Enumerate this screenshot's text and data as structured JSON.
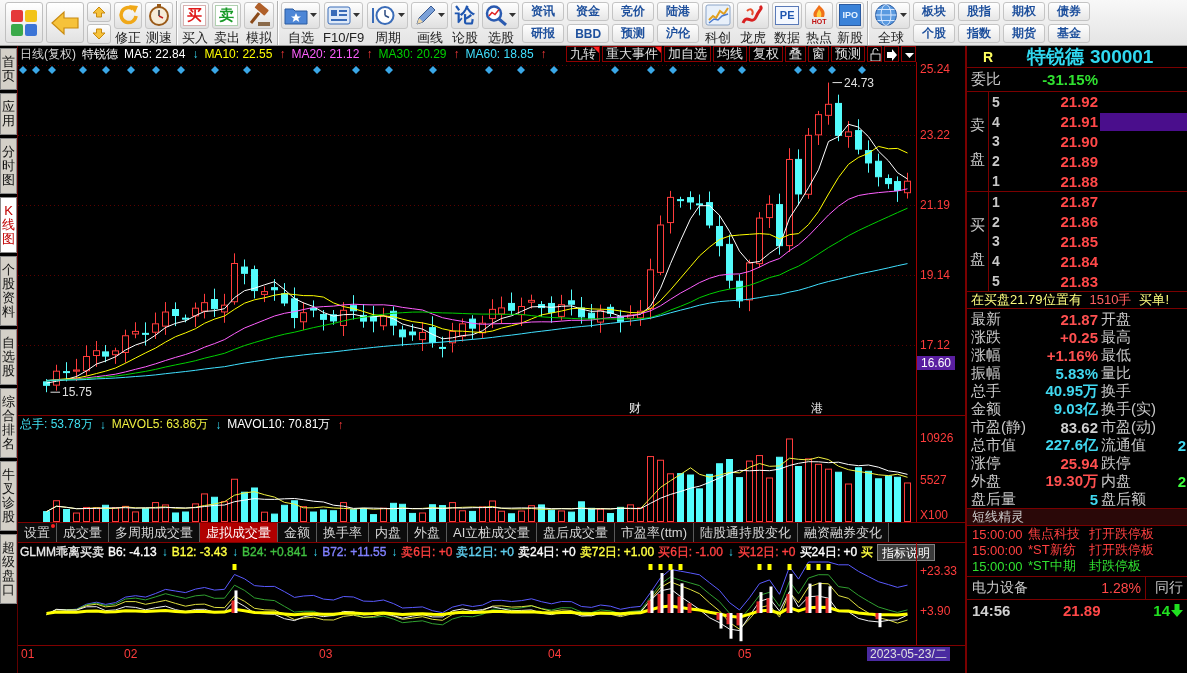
{
  "toolbar": {
    "groups": [
      {
        "items": [
          {
            "kind": "icon"
          },
          {
            "kind": "icon"
          },
          {
            "kind": "stepper"
          },
          {
            "kind": "button",
            "label": "修正"
          },
          {
            "kind": "button",
            "label": "测速"
          }
        ]
      },
      {
        "items": [
          {
            "kind": "button",
            "label": "买入",
            "glyph": "买"
          },
          {
            "kind": "button",
            "label": "卖出",
            "glyph": "卖"
          },
          {
            "kind": "button",
            "label": "模拟"
          }
        ]
      },
      {
        "items": [
          {
            "kind": "menu",
            "label": "自选"
          },
          {
            "kind": "menu",
            "label": "F10/F9"
          },
          {
            "kind": "menu",
            "label": "周期"
          },
          {
            "kind": "menu",
            "label": "画线"
          },
          {
            "kind": "button",
            "label": "论股",
            "glyph": "论"
          },
          {
            "kind": "menu",
            "label": "选股"
          },
          {
            "kind": "pair",
            "top": "资讯",
            "bottom": "研报"
          },
          {
            "kind": "pair",
            "top": "资金",
            "bottom": "BBD"
          },
          {
            "kind": "pair",
            "top": "竞价",
            "bottom": "预测"
          },
          {
            "kind": "pair",
            "top": "陆港",
            "bottom": "沪伦"
          },
          {
            "kind": "button",
            "label": "科创"
          },
          {
            "kind": "button",
            "label": "龙虎"
          },
          {
            "kind": "button",
            "label": "数据",
            "glyph": "PE"
          },
          {
            "kind": "button",
            "label": "热点",
            "glyph": "HOT"
          },
          {
            "kind": "button",
            "label": "新股",
            "glyph": "IPO"
          }
        ]
      },
      {
        "items": [
          {
            "kind": "menu",
            "label": "全球"
          },
          {
            "kind": "pair",
            "top": "板块",
            "bottom": "个股"
          },
          {
            "kind": "pair",
            "top": "股指",
            "bottom": "指数"
          },
          {
            "kind": "pair",
            "top": "期权",
            "bottom": "期货"
          },
          {
            "kind": "pair",
            "top": "债券",
            "bottom": "基金"
          }
        ]
      }
    ]
  },
  "side_tabs": [
    {
      "label": "首页",
      "selected": false
    },
    {
      "label": "应用",
      "selected": false
    },
    {
      "label": "分时图",
      "selected": false
    },
    {
      "label": "K线图",
      "selected": true
    },
    {
      "label": "个股资料",
      "selected": false
    },
    {
      "label": "自选股",
      "selected": false
    },
    {
      "label": "综合排名",
      "selected": false
    },
    {
      "label": "牛叉诊股",
      "selected": false
    },
    {
      "label": "超级盘口",
      "selected": false
    }
  ],
  "price_chart": {
    "period": "日线(复权)",
    "stock": "特锐德",
    "averages": [
      {
        "text": "MA5: 22.84",
        "arrow": "↓",
        "rising": false,
        "color": "#ffffff"
      },
      {
        "text": "MA10: 22.55",
        "arrow": "↑",
        "rising": true,
        "color": "#ffff00"
      },
      {
        "text": "MA20: 21.12",
        "arrow": "↑",
        "rising": true,
        "color": "#ff60ff"
      },
      {
        "text": "MA30: 20.29",
        "arrow": "↑",
        "rising": true,
        "color": "#00d000"
      },
      {
        "text": "MA60: 18.85",
        "arrow": "↑",
        "rising": true,
        "color": "#40e0ff"
      }
    ],
    "tools": [
      {
        "label": "九转",
        "flagged": true
      },
      {
        "label": "重大事件",
        "flagged": true
      },
      {
        "label": "加自选",
        "flagged": false
      },
      {
        "label": "均线",
        "flagged": false
      },
      {
        "label": "复权",
        "flagged": false
      },
      {
        "label": "叠",
        "flagged": false
      },
      {
        "label": "窗",
        "flagged": false
      },
      {
        "label": "预测",
        "flagged": false
      }
    ],
    "price_axis": [
      "25.24",
      "23.22",
      "21.19",
      "19.14",
      "17.12"
    ],
    "cursor_price": "16.60",
    "high_label": "24.73",
    "low_label": "15.75",
    "event_marks": [
      "财",
      "港"
    ]
  },
  "volume": {
    "stats": [
      {
        "text": "总手: 53.78万",
        "arrow": "↓",
        "rising": false,
        "color": "#40e0f0"
      },
      {
        "text": "MAVOL5: 63.86万",
        "arrow": "↓",
        "rising": false,
        "color": "#f0f040"
      },
      {
        "text": "MAVOL10: 70.81万",
        "arrow": "↑",
        "rising": true,
        "color": "#ffffff"
      }
    ],
    "axis": [
      "10926",
      "5527",
      "X100"
    ]
  },
  "indicator_tabs": [
    {
      "label": "设置",
      "selected": false,
      "dot": true
    },
    {
      "label": "成交量",
      "selected": false,
      "dot": false
    },
    {
      "label": "多周期成交量",
      "selected": false,
      "dot": false
    },
    {
      "label": "虚拟成交量",
      "selected": true,
      "dot": false
    },
    {
      "label": "金额",
      "selected": false,
      "dot": false
    },
    {
      "label": "换手率",
      "selected": false,
      "dot": false
    },
    {
      "label": "内盘",
      "selected": false,
      "dot": false
    },
    {
      "label": "外盘",
      "selected": false,
      "dot": false
    },
    {
      "label": "AI立桩成交量",
      "selected": false,
      "dot": false
    },
    {
      "label": "盘后成交量",
      "selected": false,
      "dot": false
    },
    {
      "label": "市盈率(ttm)",
      "selected": false,
      "dot": false
    },
    {
      "label": "陆股通持股变化",
      "selected": false,
      "dot": false
    },
    {
      "label": "融资融券变化",
      "selected": false,
      "dot": false
    }
  ],
  "indicator": {
    "name": "GLMM乖离买卖",
    "values": [
      {
        "text": "B6: -4.13",
        "arrow": "↓",
        "rising": false,
        "color": "#ffffff"
      },
      {
        "text": "B12: -3.43",
        "arrow": "↓",
        "rising": false,
        "color": "#ffff40"
      },
      {
        "text": "B24: +0.841",
        "arrow": "↓",
        "rising": false,
        "color": "#40c040"
      },
      {
        "text": "B72: +11.55",
        "arrow": "↓",
        "rising": false,
        "color": "#8080ff"
      },
      {
        "text": "卖6日: +0",
        "color": "#ff4040"
      },
      {
        "text": "卖12日: +0",
        "color": "#60d0f0"
      },
      {
        "text": "卖24日: +0",
        "color": "#ffffff"
      },
      {
        "text": "卖72日: +1.00",
        "color": "#ffff40"
      },
      {
        "text": "买6日: -1.00",
        "arrow": "↓",
        "rising": false,
        "color": "#ff4040"
      },
      {
        "text": "买12日: +0",
        "color": "#ff4040"
      },
      {
        "text": "买24日: +0",
        "color": "#ffffff"
      },
      {
        "text": "买",
        "color": "#ffff40"
      }
    ],
    "help": "指标说明",
    "axis": [
      "+23.33",
      "+3.90"
    ]
  },
  "time_axis": {
    "months": [
      "01",
      "02",
      "03",
      "04",
      "05"
    ],
    "cursor_date": "2023-05-23/二"
  },
  "quote_panel": {
    "flag": "R",
    "name": "特锐德",
    "code": "300001",
    "ratio": {
      "label": "委比",
      "value": "-31.15%"
    },
    "asks": {
      "label": "卖盘",
      "levels": [
        {
          "level": "5",
          "price": "21.92",
          "highlighted": false
        },
        {
          "level": "4",
          "price": "21.91",
          "highlighted": true
        },
        {
          "level": "3",
          "price": "21.90",
          "highlighted": false
        },
        {
          "level": "2",
          "price": "21.89",
          "highlighted": false
        },
        {
          "level": "1",
          "price": "21.88",
          "highlighted": false
        }
      ]
    },
    "bids": {
      "label": "买盘",
      "levels": [
        {
          "level": "1",
          "price": "21.87",
          "highlighted": false
        },
        {
          "level": "2",
          "price": "21.86",
          "highlighted": false
        },
        {
          "level": "3",
          "price": "21.85",
          "highlighted": false
        },
        {
          "level": "4",
          "price": "21.84",
          "highlighted": false
        },
        {
          "level": "5",
          "price": "21.83",
          "highlighted": false
        }
      ]
    },
    "notice": {
      "text": "在买盘21.79位置有",
      "volume": "1510手",
      "action": "买单!"
    },
    "stats": [
      {
        "label": "最新",
        "value": "21.87",
        "color": "#ff5050",
        "label2": "开盘"
      },
      {
        "label": "涨跌",
        "value": "+0.25",
        "color": "#ff5050",
        "label2": "最高"
      },
      {
        "label": "涨幅",
        "value": "+1.16%",
        "color": "#ff5050",
        "label2": "最低"
      },
      {
        "label": "振幅",
        "value": "5.83%",
        "color": "#40d8f0",
        "label2": "量比"
      },
      {
        "label": "总手",
        "value": "40.95万",
        "color": "#40d8f0",
        "label2": "换手"
      },
      {
        "label": "金额",
        "value": "9.03亿",
        "color": "#40d8f0",
        "label2": "换手(实)"
      },
      {
        "label": "市盈(静)",
        "value": "83.62",
        "color": "#d0d0d0",
        "label2": "市盈(动)"
      },
      {
        "label": "总市值",
        "value": "227.6亿",
        "color": "#40d8f0",
        "label2": "流通值",
        "extra": {
          "value": "2",
          "color": "#40d8f0"
        }
      },
      {
        "label": "涨停",
        "value": "25.94",
        "color": "#ff5050",
        "label2": "跌停"
      },
      {
        "label": "外盘",
        "value": "19.30万",
        "color": "#ff5050",
        "label2": "内盘",
        "extra": {
          "value": "2",
          "color": "#40ff40"
        }
      },
      {
        "label": "盘后量",
        "value": "5",
        "color": "#40d8f0",
        "label2": "盘后额"
      }
    ],
    "sprite": {
      "title": "短线精灵",
      "events": [
        {
          "time": "15:00:00",
          "stock": "焦点科技",
          "event": "打开跌停板",
          "color": "#ff4040"
        },
        {
          "time": "15:00:00",
          "stock": "*ST新纺",
          "event": "打开跌停板",
          "color": "#ff4040"
        },
        {
          "time": "15:00:00",
          "stock": "*ST中期",
          "event": "封跌停板",
          "color": "#30e030"
        }
      ]
    },
    "sector": {
      "name": "电力设备",
      "change": "1.28%",
      "tab": "同行"
    },
    "ticks": [
      {
        "time": "14:56",
        "price": "21.89",
        "volume": "14",
        "rising": false
      }
    ]
  }
}
